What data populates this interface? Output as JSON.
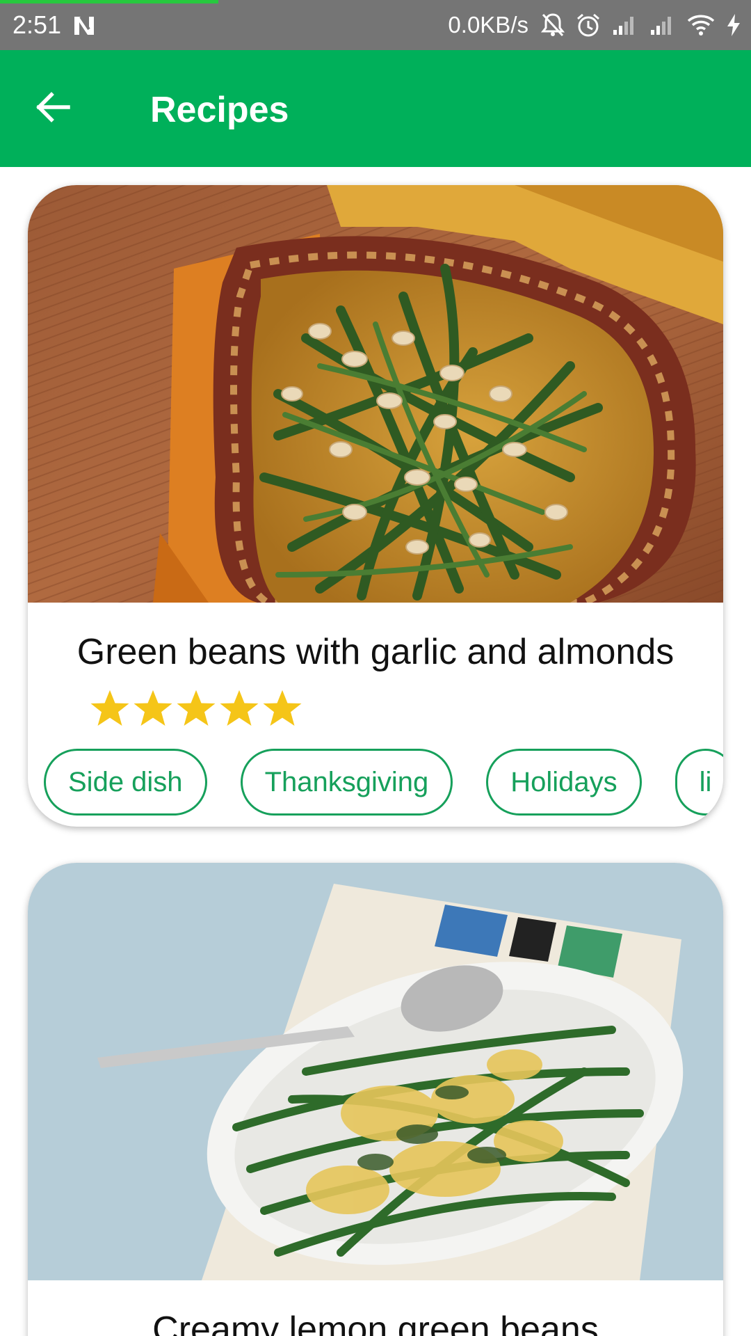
{
  "status_bar": {
    "time": "2:51",
    "network_speed": "0.0KB/s",
    "icons": [
      "n-notification-icon",
      "mute-icon",
      "alarm-icon",
      "signal-1-icon",
      "signal-2-icon",
      "wifi-icon",
      "charging-icon"
    ]
  },
  "app_bar": {
    "title": "Recipes",
    "back_icon": "arrow-left-icon",
    "color": "#00b05a"
  },
  "recipes": [
    {
      "title": "Green beans with garlic and almonds",
      "rating": 5,
      "tags": [
        "Side dish",
        "Thanksgiving",
        "Holidays",
        "li"
      ]
    },
    {
      "title": "Creamy lemon green beans"
    }
  ],
  "colors": {
    "accent": "#16a05b",
    "star": "#f5c518",
    "status_bar": "#757575"
  }
}
